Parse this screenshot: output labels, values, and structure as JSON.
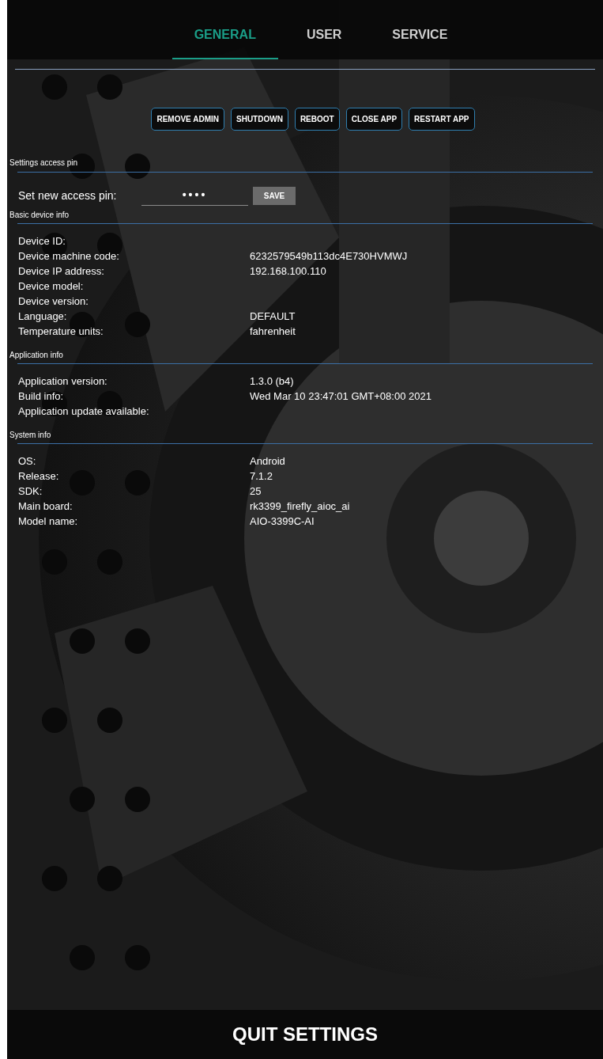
{
  "tabs": [
    {
      "label": "GENERAL",
      "selected": true
    },
    {
      "label": "USER",
      "selected": false
    },
    {
      "label": "SERVICE",
      "selected": false
    }
  ],
  "actions": [
    "REMOVE ADMIN",
    "SHUTDOWN",
    "REBOOT",
    "CLOSE APP",
    "RESTART APP"
  ],
  "pin_section": {
    "title": "Settings access pin",
    "label": "Set new access pin:",
    "value": "••••",
    "button": "SAVE"
  },
  "sections": [
    {
      "title": "Basic device info",
      "rows": [
        {
          "label": "Device ID:"
        },
        {
          "label": "Device machine code:",
          "value": "6232579549b113dc4E730HVMWJ"
        },
        {
          "label": "Device IP address:",
          "value": "192.168.100.110"
        },
        {
          "label": "Device model:"
        },
        {
          "label": "Device version:"
        },
        {
          "label": "Language:",
          "value": "DEFAULT"
        },
        {
          "label": "Temperature units:",
          "value": "fahrenheit"
        }
      ]
    },
    {
      "title": "Application info",
      "rows": [
        {
          "label": "Application version:",
          "value": "1.3.0 (b4)"
        },
        {
          "label": "Build info:",
          "value": "Wed Mar 10 23:47:01 GMT+08:00 2021"
        },
        {
          "label": "Application update available:"
        }
      ]
    },
    {
      "title": "System info",
      "rows": [
        {
          "label": "OS:",
          "value": "Android"
        },
        {
          "label": "Release:",
          "value": "7.1.2"
        },
        {
          "label": "SDK:",
          "value": "25"
        },
        {
          "label": "Main board:",
          "value": "rk3399_firefly_aioc_ai"
        },
        {
          "label": "Model name:",
          "value": "AIO-3399C-AI"
        }
      ]
    }
  ],
  "quit_button": "QUIT SETTINGS"
}
